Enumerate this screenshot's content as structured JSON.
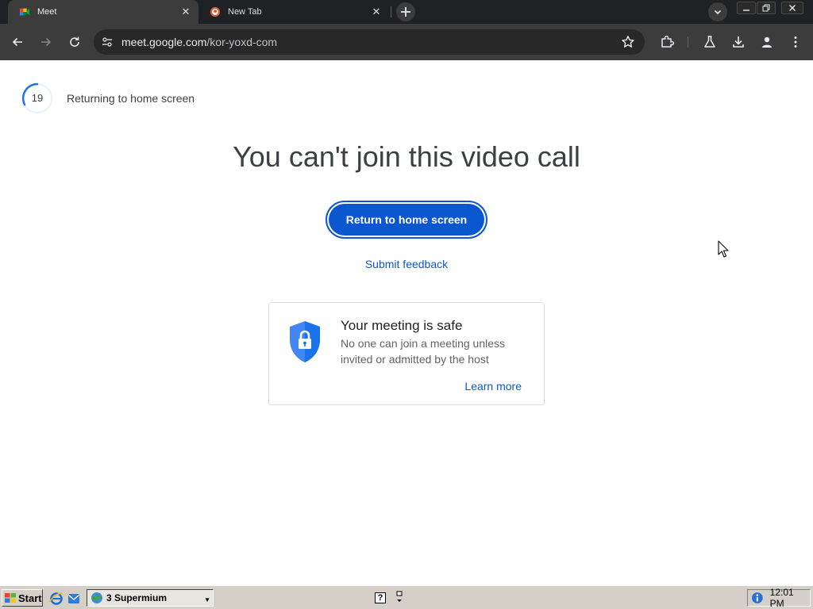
{
  "browser": {
    "tabs": [
      {
        "title": "Meet",
        "favicon": "google-meet-icon",
        "active": true
      },
      {
        "title": "New Tab",
        "favicon": "duckduckgo-icon",
        "active": false
      }
    ],
    "address": {
      "host": "meet.google.com",
      "path": "/kor-yoxd-com"
    }
  },
  "page": {
    "countdown": "19",
    "returning_text": "Returning to home screen",
    "headline": "You can't join this video call",
    "return_button": "Return to home screen",
    "feedback_link": "Submit feedback",
    "safe_card": {
      "title": "Your meeting is safe",
      "description": "No one can join a meeting unless invited or admitted by the host",
      "learn_more": "Learn more"
    }
  },
  "taskbar": {
    "start_label": "Start",
    "task_label": "3 Supermium",
    "help_glyph": "?",
    "clock": "12:01 PM"
  },
  "colors": {
    "accent": "#0b57d0",
    "chrome_dark": "#202124",
    "toolbar": "#3c3c3c",
    "text_primary": "#3c4043",
    "shield": "#4285f4"
  }
}
